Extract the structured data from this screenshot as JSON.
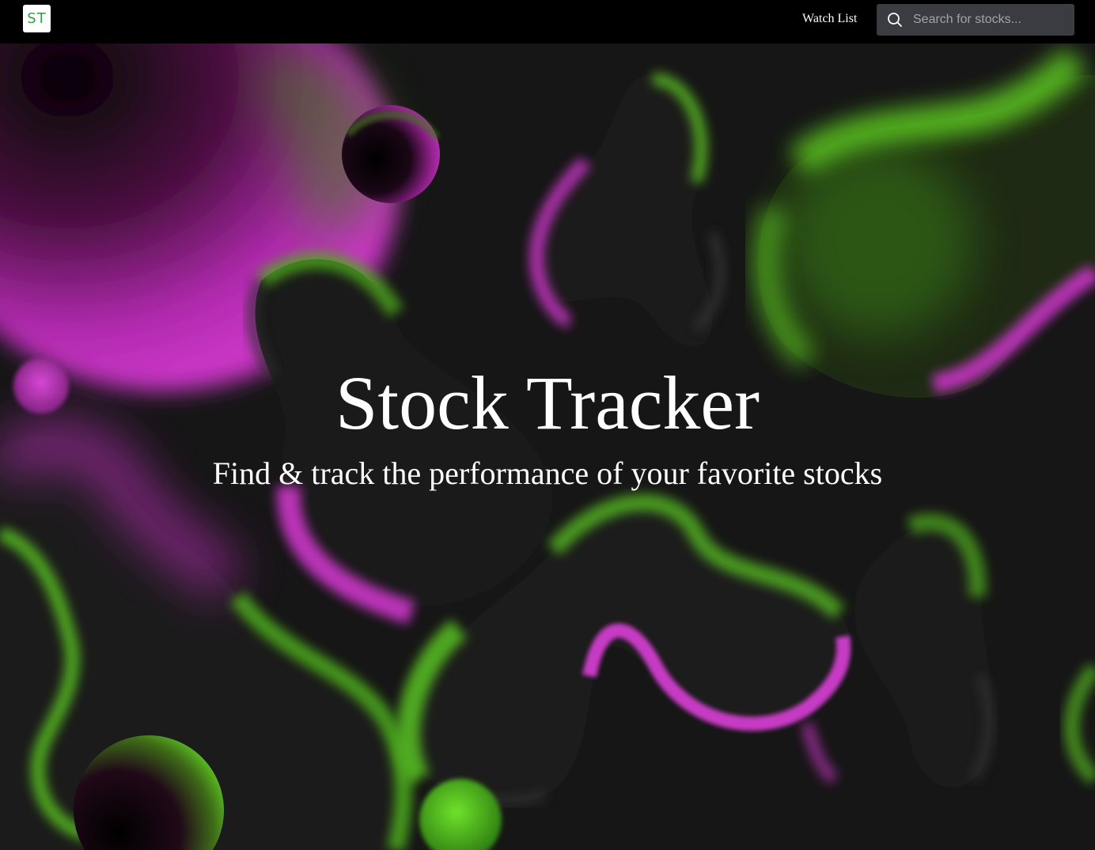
{
  "navbar": {
    "logo_text": "ST",
    "logo_color": "#3a9c4a",
    "watch_list_label": "Watch List",
    "search": {
      "placeholder": "Search for stocks...",
      "value": "",
      "icon": "search-icon"
    }
  },
  "hero": {
    "title": "Stock Tracker",
    "subtitle": "Find & track the performance of your favorite stocks"
  },
  "colors": {
    "navbar_bg": "#000000",
    "search_bg": "#3b3c41",
    "hero_bg": "#161616",
    "accent_green": "#4fbf1f",
    "accent_magenta": "#c52fc2",
    "text": "#ffffff"
  }
}
